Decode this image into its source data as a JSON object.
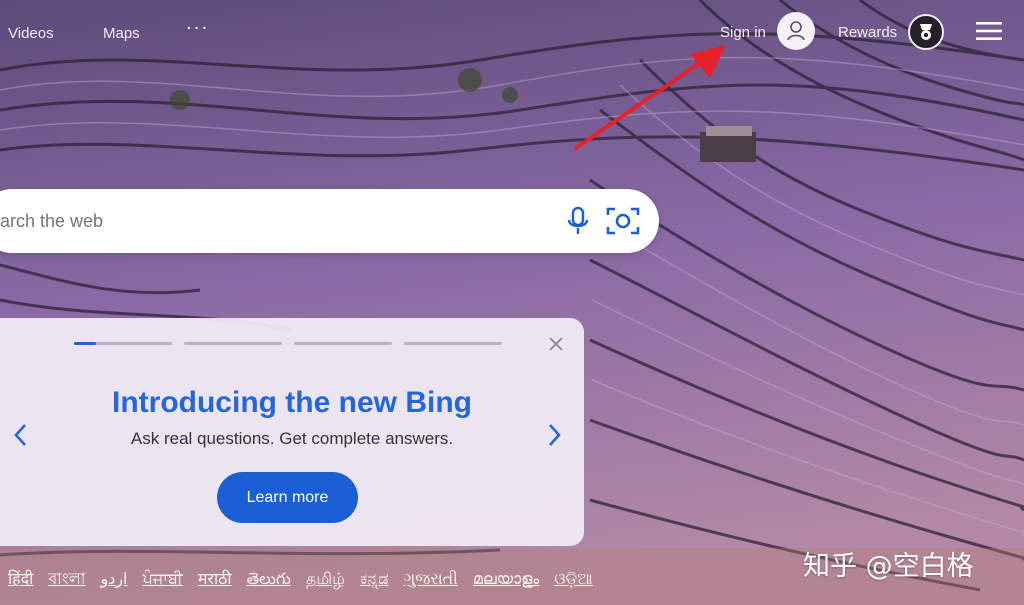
{
  "nav": {
    "videos": "Videos",
    "maps": "Maps",
    "more": "···",
    "sign_in": "Sign in",
    "rewards": "Rewards"
  },
  "search": {
    "placeholder": "arch the web"
  },
  "card": {
    "title": "Introducing the new Bing",
    "subtitle": "Ask real questions. Get complete answers.",
    "button": "Learn more",
    "progress": [
      0.22,
      0,
      0,
      0
    ]
  },
  "languages": [
    "हिंदी",
    "বাংলা",
    "اردو",
    "ਪੰਜਾਬੀ",
    "मराठी",
    "తెలుగు",
    "தமிழ்",
    "ಕನ್ನಡ",
    "ગુજરાતી",
    "മലയാളം",
    "ଓଡ଼ିଆ"
  ],
  "watermark": "知乎 @空白格",
  "colors": {
    "accent": "#2367d9",
    "button": "#1b5fd6",
    "arrow": "#e8202a"
  },
  "icons": [
    "user-icon",
    "rewards-badge-icon",
    "hamburger-menu-icon",
    "microphone-icon",
    "visual-search-icon",
    "close-icon",
    "chevron-left-icon",
    "chevron-right-icon"
  ]
}
